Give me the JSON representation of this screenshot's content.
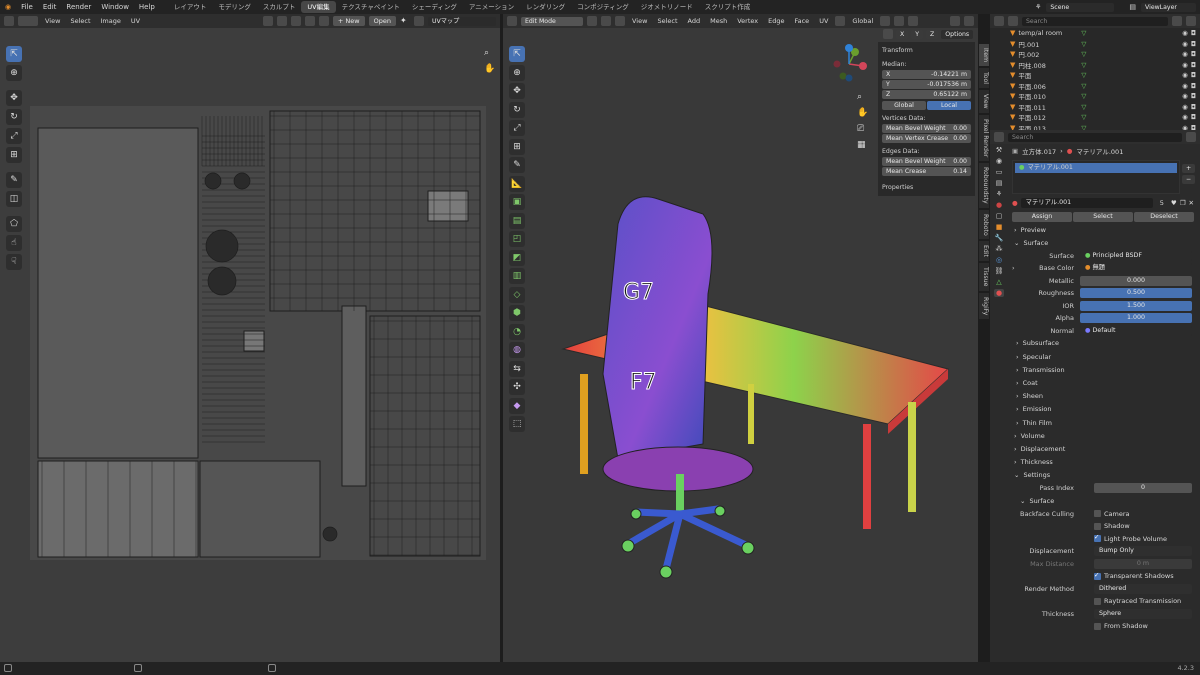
{
  "topbar": {
    "menus": [
      "File",
      "Edit",
      "Render",
      "Window",
      "Help"
    ],
    "workspaces": [
      "レイアウト",
      "モデリング",
      "スカルプト",
      "UV編集",
      "テクスチャペイント",
      "シェーディング",
      "アニメーション",
      "レンダリング",
      "コンポジティング",
      "ジオメトリノード",
      "スクリプト作成"
    ],
    "active_workspace": "UV編集",
    "scene": "Scene",
    "view_layer": "ViewLayer"
  },
  "uv_editor": {
    "menus": [
      "View",
      "Select",
      "Image",
      "UV"
    ],
    "new_label": "+ New",
    "open_label": "Open",
    "uv_map": "UVマップ"
  },
  "viewport": {
    "mode": "Edit Mode",
    "menus": [
      "View",
      "Select",
      "Add",
      "Mesh",
      "Vertex",
      "Edge",
      "Face",
      "UV"
    ],
    "orientation": "Global",
    "options": "Options",
    "axes": [
      "X",
      "Y",
      "Z"
    ]
  },
  "npanel": {
    "title": "Transform",
    "median_label": "Median:",
    "x_label": "X",
    "x_val": "-0.14221 m",
    "y_label": "Y",
    "y_val": "-0.017536 m",
    "z_label": "Z",
    "z_val": "0.65122 m",
    "global_btn": "Global",
    "local_btn": "Local",
    "vertices_label": "Vertices Data:",
    "mean_bevel_weight_label": "Mean Bevel Weight",
    "v_bevel": "0.00",
    "mean_vertex_crease_label": "Mean Vertex Crease",
    "v_crease": "0.00",
    "edges_label": "Edges Data:",
    "e_bevel_label": "Mean Bevel Weight",
    "e_bevel": "0.00",
    "e_crease_label": "Mean Crease",
    "e_crease": "0.14",
    "properties": "Properties",
    "side_tabs": [
      "Item",
      "Tool",
      "View",
      "Pixel Render",
      "Roboundsty",
      "Roboto",
      "Edit",
      "Tissue",
      "RigiFy"
    ]
  },
  "outliner": {
    "search_placeholder": "Search",
    "items": [
      "temp/al room",
      "円.001",
      "円.002",
      "円柱.008",
      "平面",
      "平面.006",
      "平面.010",
      "平面.011",
      "平面.012",
      "平面.013"
    ]
  },
  "properties": {
    "search_placeholder": "Search",
    "breadcrumb_obj": "立方体.017",
    "breadcrumb_mat": "マテリアル.001",
    "slot_name": "マテリアル.001",
    "material_name": "マテリアル.001",
    "user_count": "5",
    "assign": "Assign",
    "select": "Select",
    "deselect": "Deselect",
    "preview": "Preview",
    "surface_section": "Surface",
    "surface_label": "Surface",
    "surface_value": "Principled BSDF",
    "base_color_label": "Base Color",
    "base_color_value": "無題",
    "metallic_label": "Metallic",
    "metallic": "0.000",
    "roughness_label": "Roughness",
    "roughness": "0.500",
    "ior_label": "IOR",
    "ior": "1.500",
    "alpha_label": "Alpha",
    "alpha": "1.000",
    "normal_label": "Normal",
    "normal_value": "Default",
    "subsections": [
      "Subsurface",
      "Specular",
      "Transmission",
      "Coat",
      "Sheen",
      "Emission",
      "Thin Film"
    ],
    "volume": "Volume",
    "displacement": "Displacement",
    "thickness": "Thickness",
    "settings": "Settings",
    "pass_index_label": "Pass Index",
    "pass_index": "0",
    "surface_sub": "Surface",
    "backface_culling_label": "Backface Culling",
    "camera": "Camera",
    "shadow": "Shadow",
    "light_probe_volume": "Light Probe Volume",
    "displacement_label": "Displacement",
    "displacement_value": "Bump Only",
    "max_distance_label": "Max Distance",
    "max_distance": "0 m",
    "transparent_shadows": "Transparent Shadows",
    "render_method_label": "Render Method",
    "render_method": "Dithered",
    "raytraced_transmission": "Raytraced Transmission",
    "thickness_label": "Thickness",
    "thickness_value": "Sphere",
    "from_shadow": "From Shadow"
  },
  "statusbar": {
    "version": "4.2.3"
  },
  "colors": {
    "accent": "#4772b3",
    "bg": "#1d1d1d",
    "panel": "#2b2b2b",
    "orange": "#e48d2c"
  }
}
